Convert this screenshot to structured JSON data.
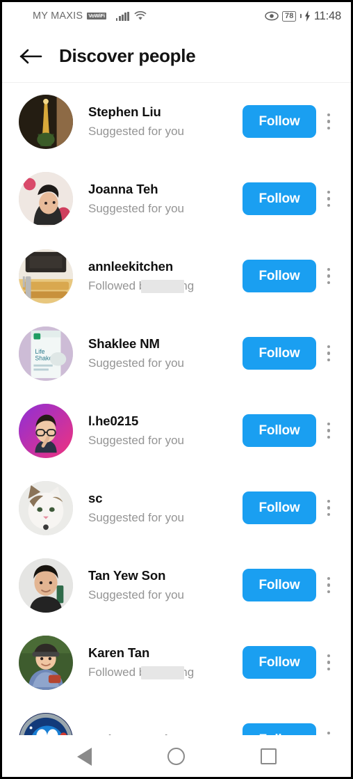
{
  "statusbar": {
    "carrier": "MY MAXIS",
    "vowifi_badge": "VoWiFi",
    "signal_icon": "signal-bars-icon",
    "wifi_icon": "wifi-icon",
    "eye_icon": "eye-icon",
    "battery_level": "78",
    "charging_icon": "charging-bolt-icon",
    "time": "11:48"
  },
  "header": {
    "back_icon": "back-arrow-icon",
    "title": "Discover people"
  },
  "colors": {
    "accent": "#1a9ff1",
    "primary_text": "#101010",
    "secondary_text": "#949494",
    "redaction": "#e6e6e6",
    "background": "#ffffff"
  },
  "list": {
    "follow_label": "Follow",
    "menu_icon": "more-options-icon",
    "items": [
      {
        "name": "Stephen Liu",
        "subtitle": "Suggested for you",
        "redacted": false,
        "avatar": "eiffel-tower-night-photo"
      },
      {
        "name": "Joanna Teh",
        "subtitle": "Suggested for you",
        "redacted": false,
        "avatar": "woman-portrait-photo"
      },
      {
        "name": "annleekitchen",
        "subtitle": "Followed by      penang",
        "redacted": true,
        "avatar": "kitchen-food-photo"
      },
      {
        "name": "Shaklee NM",
        "subtitle": "Suggested for you",
        "redacted": false,
        "avatar": "product-bottle-photo"
      },
      {
        "name": "l.he0215",
        "subtitle": "Suggested for you",
        "redacted": false,
        "avatar": "cartoon-avatar-gradient"
      },
      {
        "name": "sc",
        "subtitle": "Suggested for you",
        "redacted": false,
        "avatar": "cat-photo"
      },
      {
        "name": "Tan Yew Son",
        "subtitle": "Suggested for you",
        "redacted": false,
        "avatar": "man-portrait-photo"
      },
      {
        "name": "Karen Tan",
        "subtitle": "Followed by      penang",
        "redacted": true,
        "avatar": "child-outdoor-photo"
      },
      {
        "name": "Eetheng Yeoh",
        "subtitle": "",
        "redacted": false,
        "avatar": "doraemon-cartoon-photo"
      }
    ]
  },
  "navbar": {
    "back_icon": "android-back-icon",
    "home_icon": "android-home-icon",
    "recents_icon": "android-recents-icon"
  }
}
